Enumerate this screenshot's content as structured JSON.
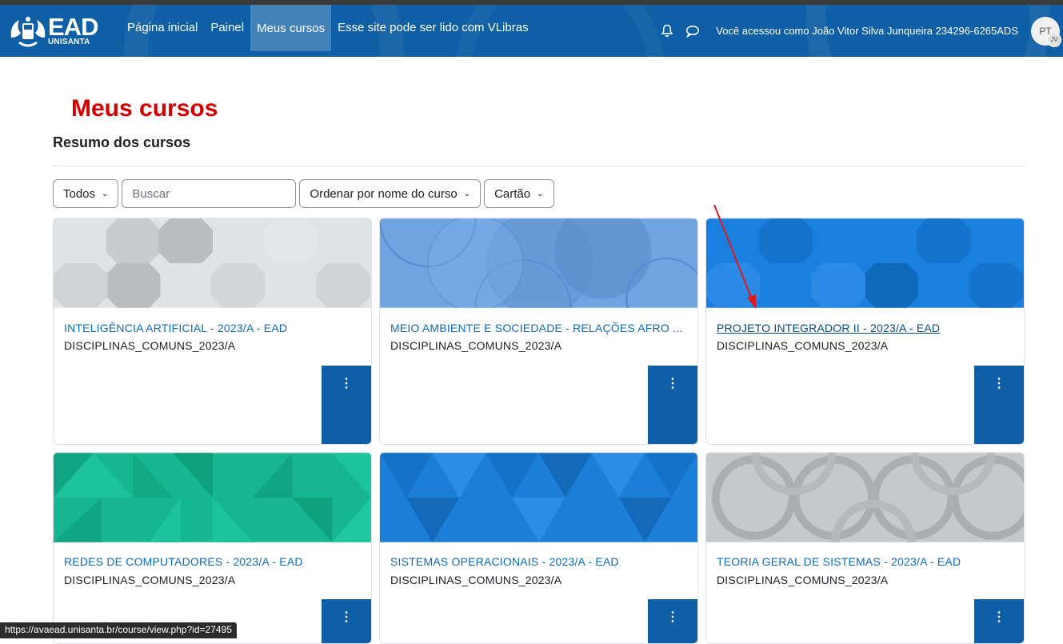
{
  "logo": {
    "text": "EAD",
    "sub": "UNISANTA"
  },
  "nav": {
    "links": [
      "Página inicial",
      "Painel",
      "Meus cursos",
      "Esse site pode ser lido com VLibras"
    ],
    "active_index": 2
  },
  "user": {
    "text": "Você acessou como João Vitor Silva Junqueira 234296-6265ADS",
    "language": "PT",
    "initials": "JV"
  },
  "page": {
    "title": "Meus cursos",
    "section_title": "Resumo dos cursos"
  },
  "filters": {
    "grouping": "Todos",
    "search_placeholder": "Buscar",
    "sort": "Ordenar por nome do curso",
    "view": "Cartão"
  },
  "courses": [
    {
      "title": "INTELIGÊNCIA ARTIFICIAL - 2023/A - EAD",
      "category": "DISCIPLINAS_COMUNS_2023/A",
      "color": "#dfe3e6"
    },
    {
      "title": "MEIO AMBIENTE E SOCIEDADE - RELAÇÕES AFRO ...",
      "category": "DISCIPLINAS_COMUNS_2023/A",
      "color": "#6fa4e0"
    },
    {
      "title": "PROJETO INTEGRADOR II - 2023/A - EAD",
      "category": "DISCIPLINAS_COMUNS_2023/A",
      "color": "#1a80e0"
    },
    {
      "title": "REDES DE COMPUTADORES - 2023/A - EAD",
      "category": "DISCIPLINAS_COMUNS_2023/A",
      "color": "#16b690"
    },
    {
      "title": "SISTEMAS OPERACIONAIS - 2023/A - EAD",
      "category": "DISCIPLINAS_COMUNS_2023/A",
      "color": "#1b7fd8"
    },
    {
      "title": "TEORIA GERAL DE SISTEMAS - 2023/A - EAD",
      "category": "DISCIPLINAS_COMUNS_2023/A",
      "color": "#bfc3c6"
    }
  ],
  "card_menu_icon": "kebab-menu-icon",
  "status_url": "https://avaead.unisanta.br/course/view.php?id=27495",
  "colors": {
    "navbar": "#0f5fa6",
    "title_red": "#d40000",
    "link": "#0f6cbf",
    "arrow": "#e0191f"
  }
}
